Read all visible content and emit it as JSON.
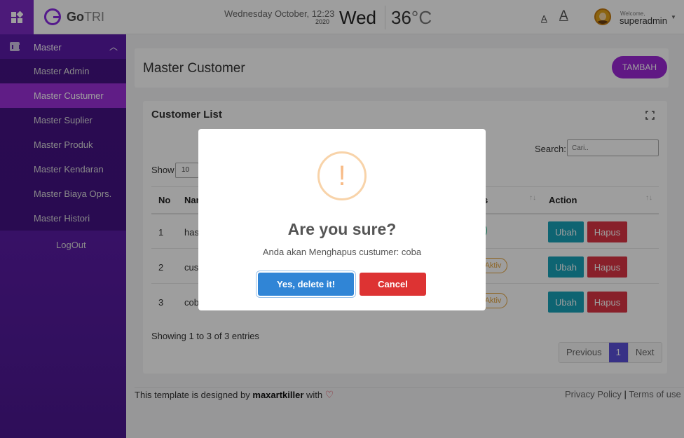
{
  "topbar": {
    "logo_go": "Go",
    "logo_tri": "TRI",
    "date": "Wednesday October, 12:23",
    "year": "2020",
    "day": "Wed",
    "temperature": "36",
    "temperature_unit": "°C",
    "font_small": "A",
    "font_large": "A",
    "welcome": "Welcome,",
    "username": "superadmin"
  },
  "sidebar": {
    "section": "Master",
    "items": [
      {
        "label": "Master Admin",
        "active": false
      },
      {
        "label": "Master Custumer",
        "active": true
      },
      {
        "label": "Master Suplier",
        "active": false
      },
      {
        "label": "Master Produk",
        "active": false
      },
      {
        "label": "Master Kendaran",
        "active": false
      },
      {
        "label": "Master Biaya Oprs.",
        "active": false
      },
      {
        "label": "Master Histori",
        "active": false
      }
    ],
    "logout": "LogOut"
  },
  "page": {
    "title": "Master Customer",
    "add_button": "TAMBAH"
  },
  "card": {
    "title": "Customer List",
    "search_label": "Search:",
    "search_placeholder": "Cari..",
    "show_label": "Show",
    "show_value": "10",
    "columns": [
      "No",
      "Nar",
      "s",
      "Action"
    ],
    "rows": [
      {
        "no": "1",
        "name": "has",
        "status": "f",
        "status_color": "#2bb58a"
      },
      {
        "no": "2",
        "name": "cus",
        "status": "n Aktiv",
        "status_color": "#e2a23a"
      },
      {
        "no": "3",
        "name": "cob",
        "status": "n Aktiv",
        "status_color": "#e2a23a"
      }
    ],
    "edit_label": "Ubah",
    "delete_label": "Hapus",
    "showing": "Showing 1 to 3 of 3 entries",
    "pagination": {
      "previous": "Previous",
      "current": "1",
      "next": "Next"
    }
  },
  "footer": {
    "prefix": "This template is designed by",
    "author": "maxartkiller",
    "with": "with",
    "privacy": "Privacy Policy",
    "separator": "|",
    "terms": "Terms of use"
  },
  "modal": {
    "icon": "!",
    "title": "Are you sure?",
    "text": "Anda akan Menghapus custumer: coba",
    "confirm": "Yes, delete it!",
    "cancel": "Cancel"
  },
  "colors": {
    "sidebar": "#5b1aa8",
    "accent": "#9b27d6",
    "confirm": "#3085d6",
    "cancel": "#dd3333",
    "edit": "#17a2b8",
    "delete": "#dc3545",
    "warning": "#f8bb86"
  }
}
